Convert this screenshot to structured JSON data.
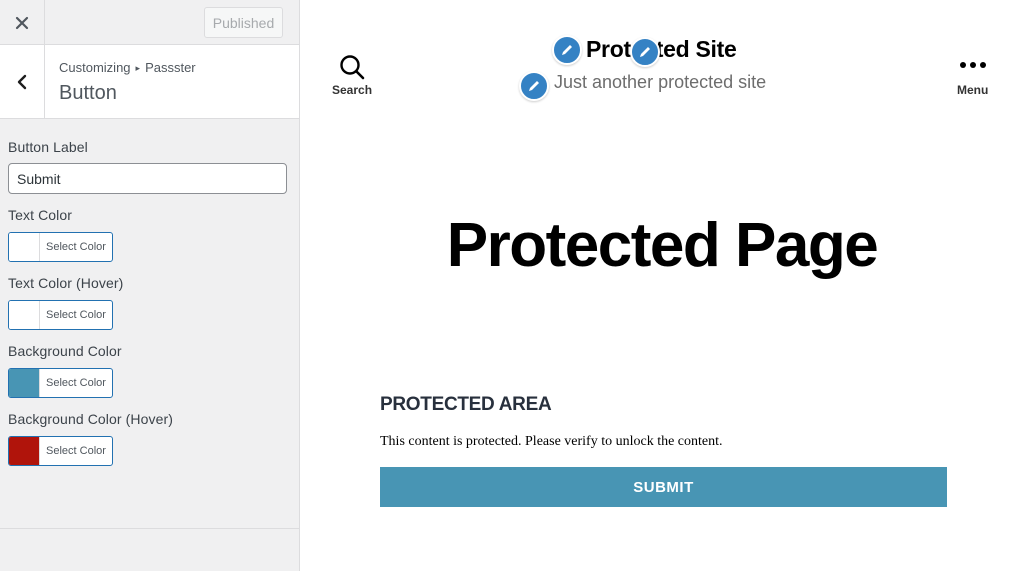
{
  "topbar": {
    "close_icon": "close-icon",
    "published_label": "Published"
  },
  "section": {
    "back_icon": "chevron-left-icon",
    "breadcrumb_root": "Customizing",
    "breadcrumb_separator": "▸",
    "breadcrumb_child": "Passster",
    "title": "Button"
  },
  "controls": {
    "button_label": {
      "label": "Button Label",
      "value": "Submit"
    },
    "text_color": {
      "label": "Text Color",
      "button": "Select Color",
      "color": "#ffffff"
    },
    "text_color_hover": {
      "label": "Text Color (Hover)",
      "button": "Select Color",
      "color": "#ffffff"
    },
    "background_color": {
      "label": "Background Color",
      "button": "Select Color",
      "color": "#4895b4"
    },
    "background_color_hover": {
      "label": "Background Color (Hover)",
      "button": "Select Color",
      "color": "#b0140b"
    }
  },
  "preview": {
    "search_label": "Search",
    "menu_label": "Menu",
    "site_title": "Protected Site",
    "site_tagline": "Just another protected site",
    "page_heading": "Protected Page",
    "area_title": "PROTECTED AREA",
    "area_text": "This content is protected. Please verify to unlock the content.",
    "submit_label": "SUBMIT",
    "submit_bg": "#4895b4",
    "edit_bubble_color": "#3582c4"
  }
}
